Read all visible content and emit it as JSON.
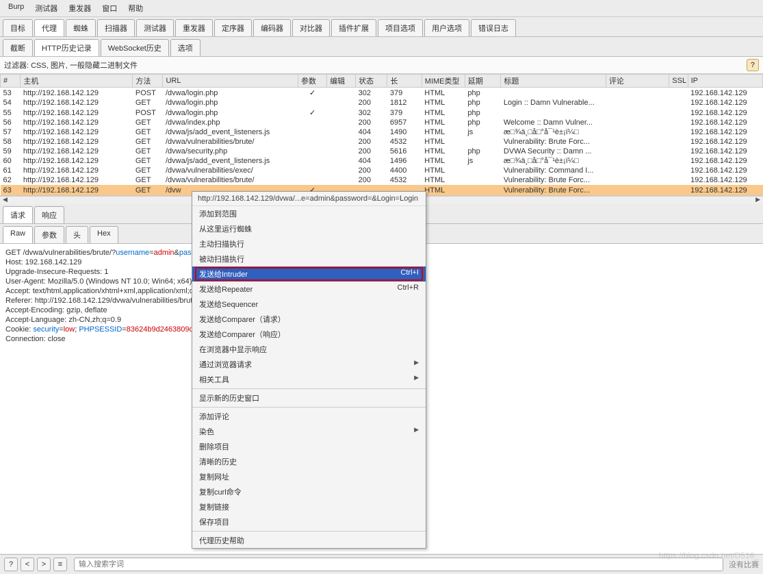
{
  "menu": [
    "Burp",
    "测试器",
    "重发器",
    "窗口",
    "帮助"
  ],
  "tabs": [
    "目标",
    "代理",
    "蜘蛛",
    "扫描器",
    "测试器",
    "重发器",
    "定序器",
    "编码器",
    "对比器",
    "插件扩展",
    "项目选项",
    "用户选项",
    "错误日志"
  ],
  "active_tab_index": 1,
  "sub_tabs": [
    "截断",
    "HTTP历史记录",
    "WebSocket历史",
    "选项"
  ],
  "active_sub_tab_index": 1,
  "filter_label": "过滤器: CSS, 图片, 一般隐藏二进制文件",
  "table": {
    "headers": [
      "#",
      "主机",
      "方法",
      "URL",
      "参数",
      "编辑",
      "状态",
      "长",
      "MIME类型",
      "延期",
      "标题",
      "评论",
      "SSL",
      "IP"
    ],
    "rows": [
      {
        "num": "53",
        "host": "http://192.168.142.129",
        "method": "POST",
        "url": "/dvwa/login.php",
        "params": true,
        "edit": "",
        "status": "302",
        "len": "379",
        "mime": "HTML",
        "ext": "php",
        "title": "",
        "comment": "",
        "ssl": "",
        "ip": "192.168.142.129"
      },
      {
        "num": "54",
        "host": "http://192.168.142.129",
        "method": "GET",
        "url": "/dvwa/login.php",
        "params": false,
        "edit": "",
        "status": "200",
        "len": "1812",
        "mime": "HTML",
        "ext": "php",
        "title": "Login :: Damn Vulnerable...",
        "comment": "",
        "ssl": "",
        "ip": "192.168.142.129"
      },
      {
        "num": "55",
        "host": "http://192.168.142.129",
        "method": "POST",
        "url": "/dvwa/login.php",
        "params": true,
        "edit": "",
        "status": "302",
        "len": "379",
        "mime": "HTML",
        "ext": "php",
        "title": "",
        "comment": "",
        "ssl": "",
        "ip": "192.168.142.129"
      },
      {
        "num": "56",
        "host": "http://192.168.142.129",
        "method": "GET",
        "url": "/dvwa/index.php",
        "params": false,
        "edit": "",
        "status": "200",
        "len": "6957",
        "mime": "HTML",
        "ext": "php",
        "title": "Welcome :: Damn Vulner...",
        "comment": "",
        "ssl": "",
        "ip": "192.168.142.129"
      },
      {
        "num": "57",
        "host": "http://192.168.142.129",
        "method": "GET",
        "url": "/dvwa/js/add_event_listeners.js",
        "params": false,
        "edit": "",
        "status": "404",
        "len": "1490",
        "mime": "HTML",
        "ext": "js",
        "title": "æ□¾ä¸□å□°å¯¹è±¡ï¼□",
        "comment": "",
        "ssl": "",
        "ip": "192.168.142.129"
      },
      {
        "num": "58",
        "host": "http://192.168.142.129",
        "method": "GET",
        "url": "/dvwa/vulnerabilities/brute/",
        "params": false,
        "edit": "",
        "status": "200",
        "len": "4532",
        "mime": "HTML",
        "ext": "",
        "title": "Vulnerability: Brute Forc...",
        "comment": "",
        "ssl": "",
        "ip": "192.168.142.129"
      },
      {
        "num": "59",
        "host": "http://192.168.142.129",
        "method": "GET",
        "url": "/dvwa/security.php",
        "params": false,
        "edit": "",
        "status": "200",
        "len": "5616",
        "mime": "HTML",
        "ext": "php",
        "title": "DVWA Security :: Damn ...",
        "comment": "",
        "ssl": "",
        "ip": "192.168.142.129"
      },
      {
        "num": "60",
        "host": "http://192.168.142.129",
        "method": "GET",
        "url": "/dvwa/js/add_event_listeners.js",
        "params": false,
        "edit": "",
        "status": "404",
        "len": "1496",
        "mime": "HTML",
        "ext": "js",
        "title": "æ□¾ä¸□å□°å¯¹è±¡ï¼□",
        "comment": "",
        "ssl": "",
        "ip": "192.168.142.129"
      },
      {
        "num": "61",
        "host": "http://192.168.142.129",
        "method": "GET",
        "url": "/dvwa/vulnerabilities/exec/",
        "params": false,
        "edit": "",
        "status": "200",
        "len": "4400",
        "mime": "HTML",
        "ext": "",
        "title": "Vulnerability: Command I...",
        "comment": "",
        "ssl": "",
        "ip": "192.168.142.129"
      },
      {
        "num": "62",
        "host": "http://192.168.142.129",
        "method": "GET",
        "url": "/dvwa/vulnerabilities/brute/",
        "params": false,
        "edit": "",
        "status": "200",
        "len": "4532",
        "mime": "HTML",
        "ext": "",
        "title": "Vulnerability: Brute Forc...",
        "comment": "",
        "ssl": "",
        "ip": "192.168.142.129"
      },
      {
        "num": "63",
        "host": "http://192.168.142.129",
        "method": "GET",
        "url": "/dvw",
        "params": true,
        "edit": "",
        "status": "",
        "len": "",
        "mime": "HTML",
        "ext": "",
        "title": "Vulnerability: Brute Forc...",
        "comment": "",
        "ssl": "",
        "ip": "192.168.142.129",
        "selected": true
      }
    ]
  },
  "mid_tabs": [
    "请求",
    "响应"
  ],
  "active_mid_tab_index": 0,
  "view_tabs": [
    "Raw",
    "参数",
    "头",
    "Hex"
  ],
  "active_view_tab_index": 0,
  "request": {
    "line1_a": "GET /dvwa/vulnerabilities/brute/?",
    "line1_b": "username",
    "line1_c": "=",
    "line1_d": "admin",
    "line1_e": "&",
    "line1_f": "password",
    "line1_g": "=&",
    "host": "Host: 192.168.142.129",
    "upgrade": "Upgrade-Insecure-Requests: 1",
    "ua": "User-Agent: Mozilla/5.0 (Windows NT 10.0; Win64; x64) AppleW",
    "accept": "Accept: text/html,application/xhtml+xml,application/xml;q=0.9,ima",
    "referer": "Referer: http://192.168.142.129/dvwa/vulnerabilities/brute/",
    "enc": "Accept-Encoding: gzip, deflate",
    "lang": "Accept-Language: zh-CN,zh;q=0.9",
    "cookie_a": "Cookie: ",
    "cookie_b": "security",
    "cookie_c": "=",
    "cookie_d": "low",
    "cookie_e": "; ",
    "cookie_f": "PHPSESSID",
    "cookie_g": "=",
    "cookie_h": "83624b9d2463809d1cb1aa4",
    "conn": "Connection: close"
  },
  "context_menu": {
    "url": "http://192.168.142.129/dvwa/...e=admin&password=&Login=Login",
    "items": [
      {
        "label": "添加到范围"
      },
      {
        "label": "从这里运行蜘蛛"
      },
      {
        "label": "主动扫描执行"
      },
      {
        "label": "被动扫描执行"
      },
      {
        "label": "发送给Intruder",
        "shortcut": "Ctrl+I",
        "hl": true
      },
      {
        "label": "发送给Repeater",
        "shortcut": "Ctrl+R"
      },
      {
        "label": "发送给Sequencer"
      },
      {
        "label": "发送给Comparer（请求）"
      },
      {
        "label": "发送给Comparer（响应）"
      },
      {
        "label": "在浏览器中显示响应"
      },
      {
        "label": "通过浏览器请求",
        "sub": true
      },
      {
        "label": "相关工具",
        "sub": true
      },
      {
        "sep": true
      },
      {
        "label": "显示新的历史窗口"
      },
      {
        "sep": true
      },
      {
        "label": "添加评论"
      },
      {
        "label": "染色",
        "sub": true
      },
      {
        "label": "删除项目"
      },
      {
        "label": "清晰的历史"
      },
      {
        "label": "复制网址"
      },
      {
        "label": "复制curl命令"
      },
      {
        "label": "复制链接"
      },
      {
        "label": "保存项目"
      },
      {
        "sep": true
      },
      {
        "label": "代理历史帮助"
      }
    ]
  },
  "footer": {
    "help": "?",
    "back": "<",
    "fwd": ">",
    "menu": "≡",
    "placeholder": "输入搜索字词",
    "match": "没有比赛"
  },
  "watermark": "https://blog.csdn.net/D516_"
}
